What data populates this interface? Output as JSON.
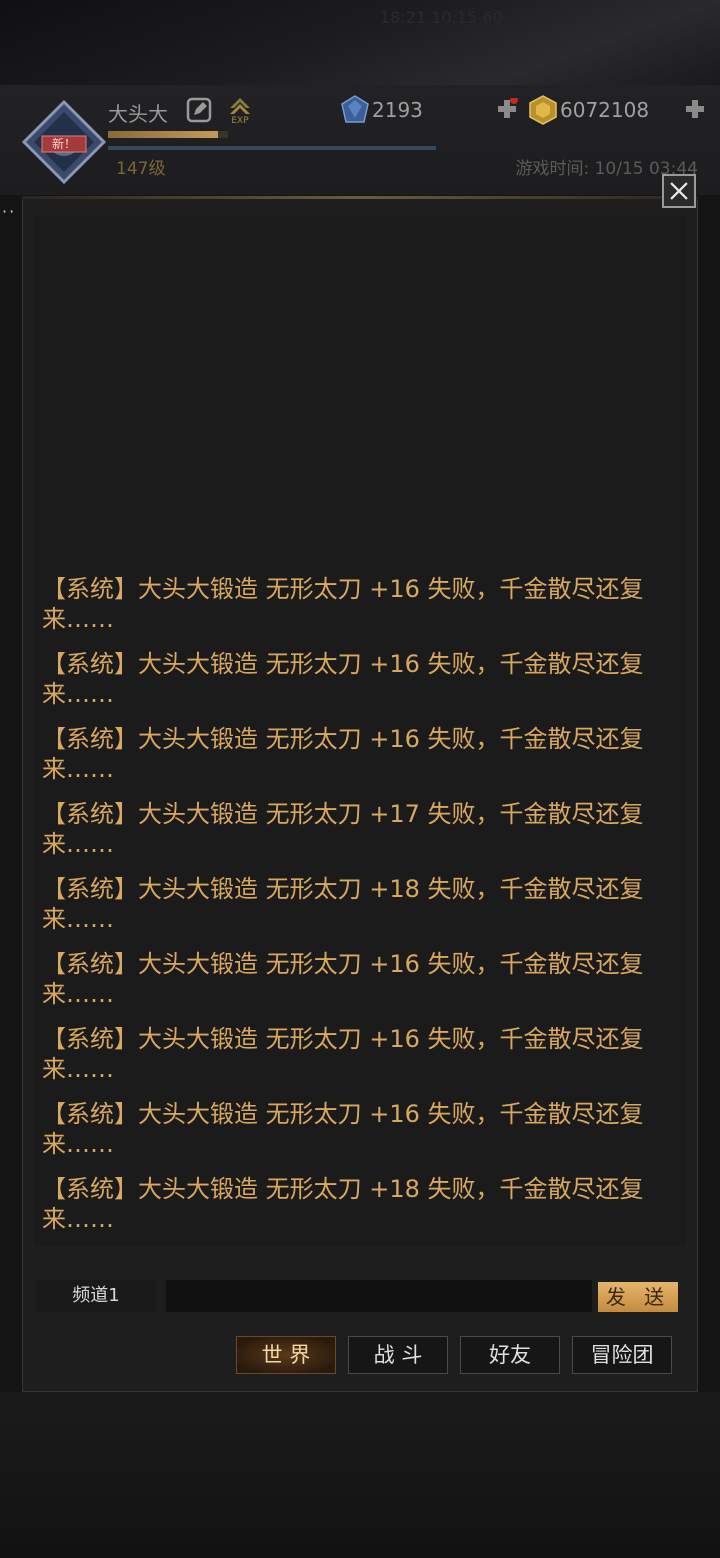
{
  "status_bar": {
    "time": "18:21 10:15 60"
  },
  "header": {
    "avatar_badge": "新！",
    "player_name": "大头大",
    "exp_label": "EXP",
    "exp_progress": 0.92,
    "level": "147级",
    "gems": "2193",
    "gold": "6072108",
    "game_time": "游戏时间: 10/15 03:44"
  },
  "side": {
    "dots": "··"
  },
  "chat": {
    "messages": [
      "【系统】大头大锻造 无形太刀 +16 失败，千金散尽还复来……",
      "【系统】大头大锻造 无形太刀 +16 失败，千金散尽还复来……",
      "【系统】大头大锻造 无形太刀 +16 失败，千金散尽还复来……",
      "【系统】大头大锻造 无形太刀 +17 失败，千金散尽还复来……",
      "【系统】大头大锻造 无形太刀 +18 失败，千金散尽还复来……",
      "【系统】大头大锻造 无形太刀 +16 失败，千金散尽还复来……",
      "【系统】大头大锻造 无形太刀 +16 失败，千金散尽还复来……",
      "【系统】大头大锻造 无形太刀 +16 失败，千金散尽还复来……",
      "【系统】大头大锻造 无形太刀 +18 失败，千金散尽还复来……"
    ],
    "channel": "频道1",
    "input_value": "",
    "send_label": "发 送"
  },
  "tabs": [
    {
      "label": "世 界",
      "active": true
    },
    {
      "label": "战 斗",
      "active": false
    },
    {
      "label": "好友",
      "active": false
    },
    {
      "label": "冒险团",
      "active": false
    }
  ],
  "colors": {
    "message_text": "#d9a860",
    "send_button": "#d9a55a",
    "active_tab": "#5a3a1a"
  }
}
